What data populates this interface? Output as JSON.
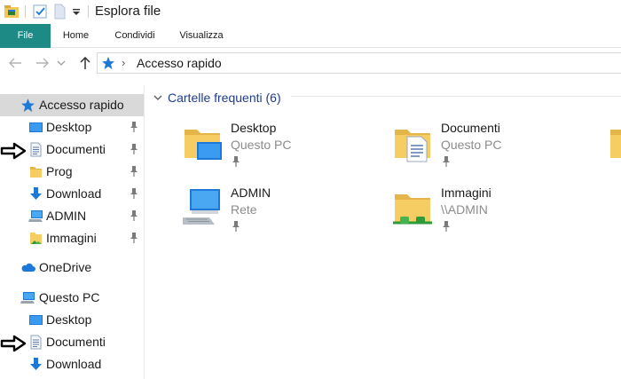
{
  "window": {
    "title": "Esplora file"
  },
  "ribbon": {
    "tabs": [
      {
        "label": "File",
        "active": true
      },
      {
        "label": "Home"
      },
      {
        "label": "Condividi"
      },
      {
        "label": "Visualizza"
      }
    ]
  },
  "address": {
    "path": "Accesso rapido"
  },
  "navpane": {
    "quick_access": {
      "label": "Accesso rapido",
      "items": [
        {
          "label": "Desktop",
          "icon": "desktop-icon",
          "pinned": true
        },
        {
          "label": "Documenti",
          "icon": "documents-icon",
          "pinned": true
        },
        {
          "label": "Prog",
          "icon": "folder-icon",
          "pinned": true
        },
        {
          "label": "Download",
          "icon": "download-icon",
          "pinned": true
        },
        {
          "label": "ADMIN",
          "icon": "computer-icon",
          "pinned": true
        },
        {
          "label": "Immagini",
          "icon": "pictures-icon",
          "pinned": true
        }
      ]
    },
    "onedrive": {
      "label": "OneDrive"
    },
    "this_pc": {
      "label": "Questo PC",
      "items": [
        {
          "label": "Desktop",
          "icon": "desktop-icon"
        },
        {
          "label": "Documenti",
          "icon": "documents-icon"
        },
        {
          "label": "Download",
          "icon": "download-icon"
        }
      ]
    }
  },
  "content": {
    "group_title": "Cartelle frequenti (6)",
    "tiles": [
      {
        "name": "Desktop",
        "sub": "Questo PC",
        "icon": "desktop-folder-icon"
      },
      {
        "name": "Documenti",
        "sub": "Questo PC",
        "icon": "documents-folder-icon"
      },
      {
        "name": "ADMIN",
        "sub": "Rete",
        "icon": "network-computer-icon"
      },
      {
        "name": "Immagini",
        "sub": "\\\\ADMIN",
        "icon": "network-folder-icon"
      }
    ]
  },
  "colors": {
    "file_tab": "#1e8a86",
    "selection": "#d9d9d9",
    "group_title": "#1f3d8a",
    "folder": "#f3c758",
    "accent_blue": "#1e78d7"
  }
}
